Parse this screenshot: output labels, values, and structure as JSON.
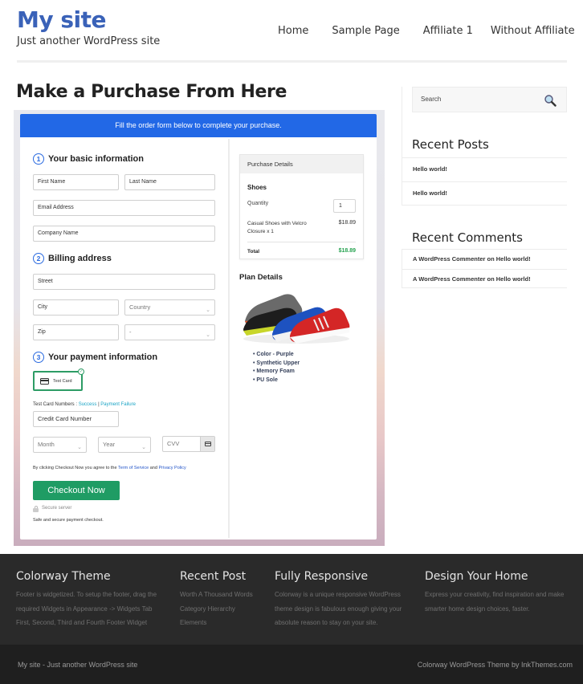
{
  "header": {
    "site_title": "My site",
    "tagline": "Just another WordPress site",
    "nav": [
      "Home",
      "Sample Page",
      "Affiliate 1",
      "Without Affiliate"
    ]
  },
  "page": {
    "title": "Make a Purchase From Here"
  },
  "checkout": {
    "banner": "Fill the order form below to complete your purchase.",
    "section1": {
      "num": "1",
      "title": "Your basic information"
    },
    "section2": {
      "num": "2",
      "title": "Billing address"
    },
    "section3": {
      "num": "3",
      "title": "Your payment information"
    },
    "fields": {
      "first_name": "First Name",
      "last_name": "Last Name",
      "email": "Email Address",
      "company": "Company Name",
      "street": "Street",
      "city": "City",
      "country": "Country",
      "zip": "Zip",
      "state": "-",
      "card_number": "Credit Card Number",
      "month": "Month",
      "year": "Year",
      "cvv": "CVV"
    },
    "payment_method": "Test Card",
    "test_card_label": "Test Card Numbers :",
    "test_success": "Success",
    "test_separator": "|",
    "test_failure": "Payment Failure",
    "agree_prefix": "By clicking Checkout Now you agree to the",
    "terms": "Term of Service",
    "and": "and",
    "privacy": "Privacy Policy",
    "checkout_button": "Checkout Now",
    "secure_server": "Secure server",
    "secure_note": "Safe and secure payment checkout."
  },
  "purchase": {
    "header": "Purchase Details",
    "product": "Shoes",
    "quantity_label": "Quantity",
    "quantity": "1",
    "item": "Casual Shoes with Velcro Closure x 1",
    "item_price": "$18.89",
    "total_label": "Total",
    "total": "$18.89",
    "total_color": "#27a351"
  },
  "plan": {
    "title": "Plan Details",
    "image": "running-shoes-image",
    "features": [
      "Color - Purple",
      "Synthetic Upper",
      "Memory Foam",
      "PU Sole"
    ]
  },
  "sidebar": {
    "search_placeholder": "Search",
    "recent_posts_title": "Recent Posts",
    "recent_posts": [
      "Hello world!",
      "Hello world!"
    ],
    "recent_comments_title": "Recent Comments",
    "recent_comments": [
      "A WordPress Commenter on Hello world!",
      "A WordPress Commenter on Hello world!"
    ]
  },
  "footer": {
    "columns": [
      {
        "title": "Colorway Theme",
        "lines": [
          "Footer is widgetized. To setup the footer, drag the",
          "required Widgets in Appearance -> Widgets Tab",
          "First, Second, Third and Fourth Footer Widget"
        ]
      },
      {
        "title": "Recent Post",
        "lines": [
          "Worth A Thousand Words",
          "Category Hierarchy",
          "Elements"
        ]
      },
      {
        "title": "Fully Responsive",
        "lines": [
          "Colorway is a unique responsive WordPress",
          "theme design is fabulous enough giving your",
          "absolute reason to stay on your site."
        ]
      },
      {
        "title": "Design Your Home",
        "lines": [
          "Express your creativity, find inspiration and make",
          "smarter home design choices, faster."
        ]
      }
    ],
    "bottom_left": "My site - Just another WordPress site",
    "bottom_right": "Colorway WordPress Theme by InkThemes.com"
  },
  "colors": {
    "brand_blue": "#3a62b8",
    "banner_blue": "#2268e6",
    "checkout_green": "#1f9c64",
    "footer_bg": "#2a2a2a"
  }
}
